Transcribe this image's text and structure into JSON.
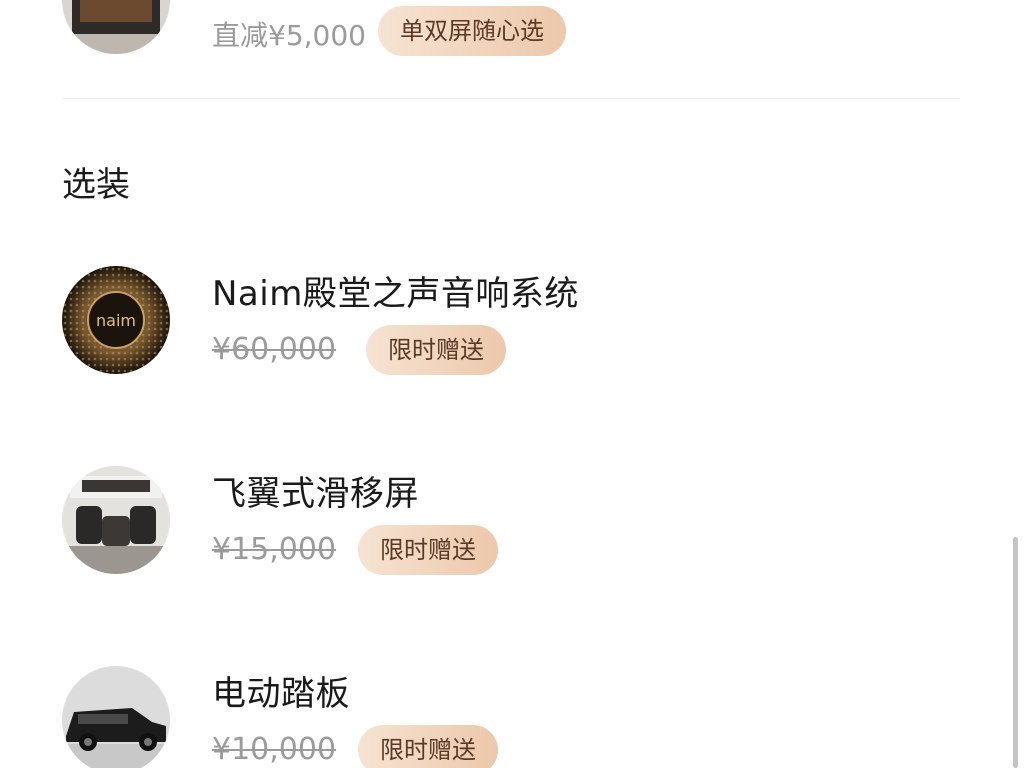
{
  "top_item": {
    "price": "直减¥5,000",
    "badge": "单双屏随心选"
  },
  "section": {
    "title": "选装"
  },
  "options": [
    {
      "name": "Naim殿堂之声音响系统",
      "price": "¥60,000",
      "badge": "限时赠送",
      "icon": "naim-speaker-icon",
      "logo_text": "naim"
    },
    {
      "name": "飞翼式滑移屏",
      "price": "¥15,000",
      "badge": "限时赠送",
      "icon": "cabin-interior-icon"
    },
    {
      "name": "电动踏板",
      "price": "¥10,000",
      "badge": "限时赠送",
      "icon": "suv-side-icon"
    }
  ],
  "colors": {
    "badge_bg_start": "#f6e3d2",
    "badge_bg_end": "#ecc8ab",
    "badge_text": "#5a3a25",
    "price_grey": "#9b9b9b"
  }
}
